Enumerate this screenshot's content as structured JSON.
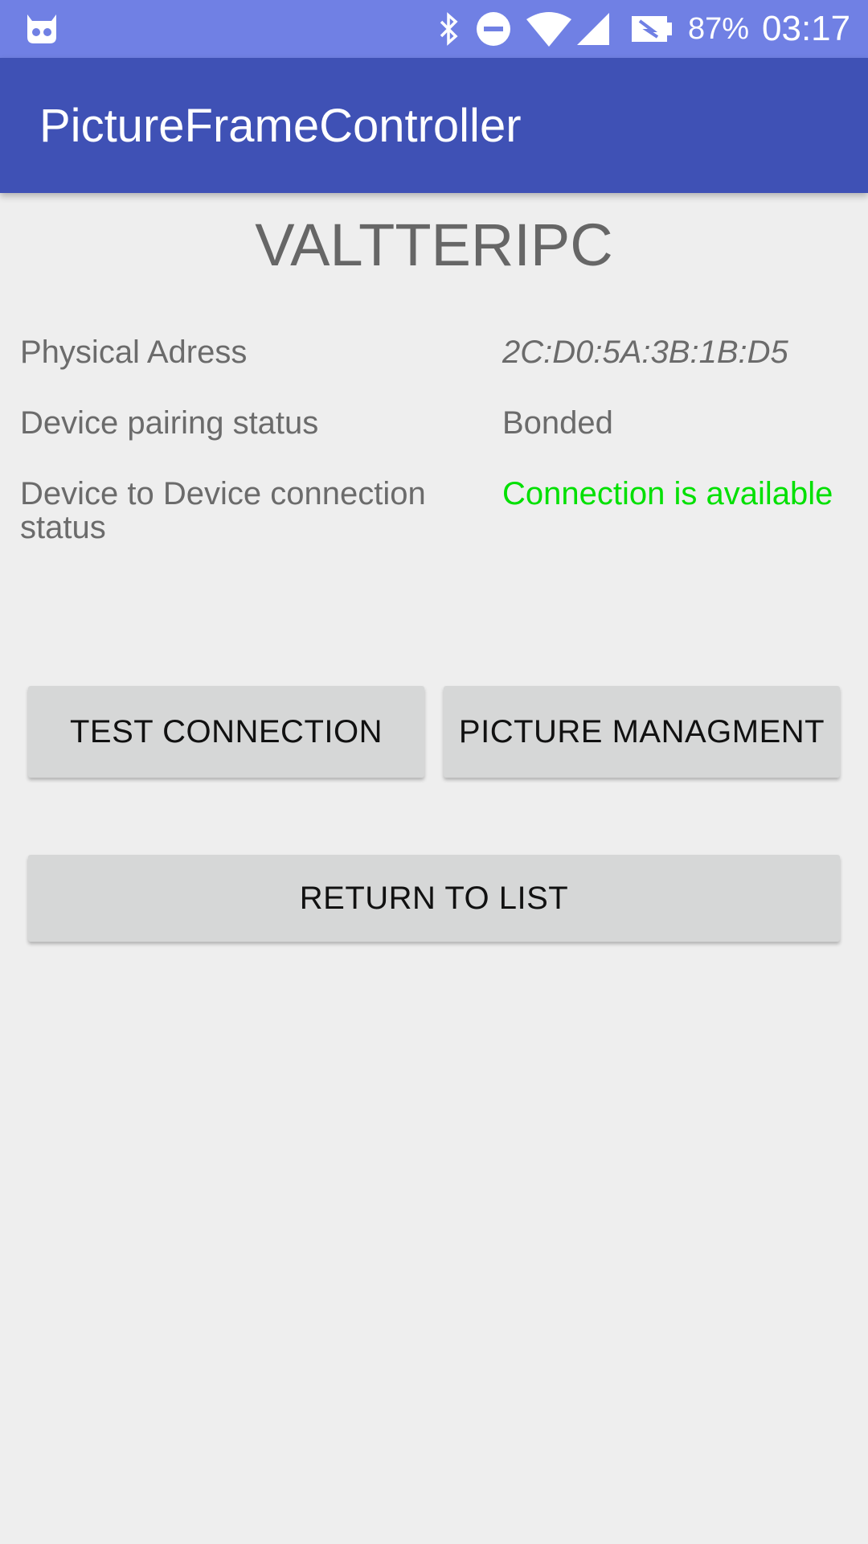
{
  "status_bar": {
    "left_icon": "app-notification-icon",
    "icons": [
      "bluetooth-icon",
      "do-not-disturb-icon",
      "wifi-icon",
      "cell-signal-icon",
      "battery-saver-icon"
    ],
    "battery_percent": "87%",
    "time": "03:17"
  },
  "app_bar": {
    "title": "PictureFrameController"
  },
  "device": {
    "name": "VALTTERIPC",
    "physical_address_label": "Physical Adress",
    "physical_address_value": "2C:D0:5A:3B:1B:D5",
    "pairing_status_label": "Device pairing status",
    "pairing_status_value": "Bonded",
    "connection_status_label": "Device to Device connection status",
    "connection_status_value": "Connection is available",
    "connection_status_color": "#00e000"
  },
  "buttons": {
    "test_connection": "TEST CONNECTION",
    "picture_management": "PICTURE MANAGMENT",
    "return_to_list": "RETURN TO LIST"
  },
  "colors": {
    "status_bar": "#7080e4",
    "app_bar": "#3f51b5",
    "background": "#eeeeee",
    "button": "#d6d7d7"
  }
}
